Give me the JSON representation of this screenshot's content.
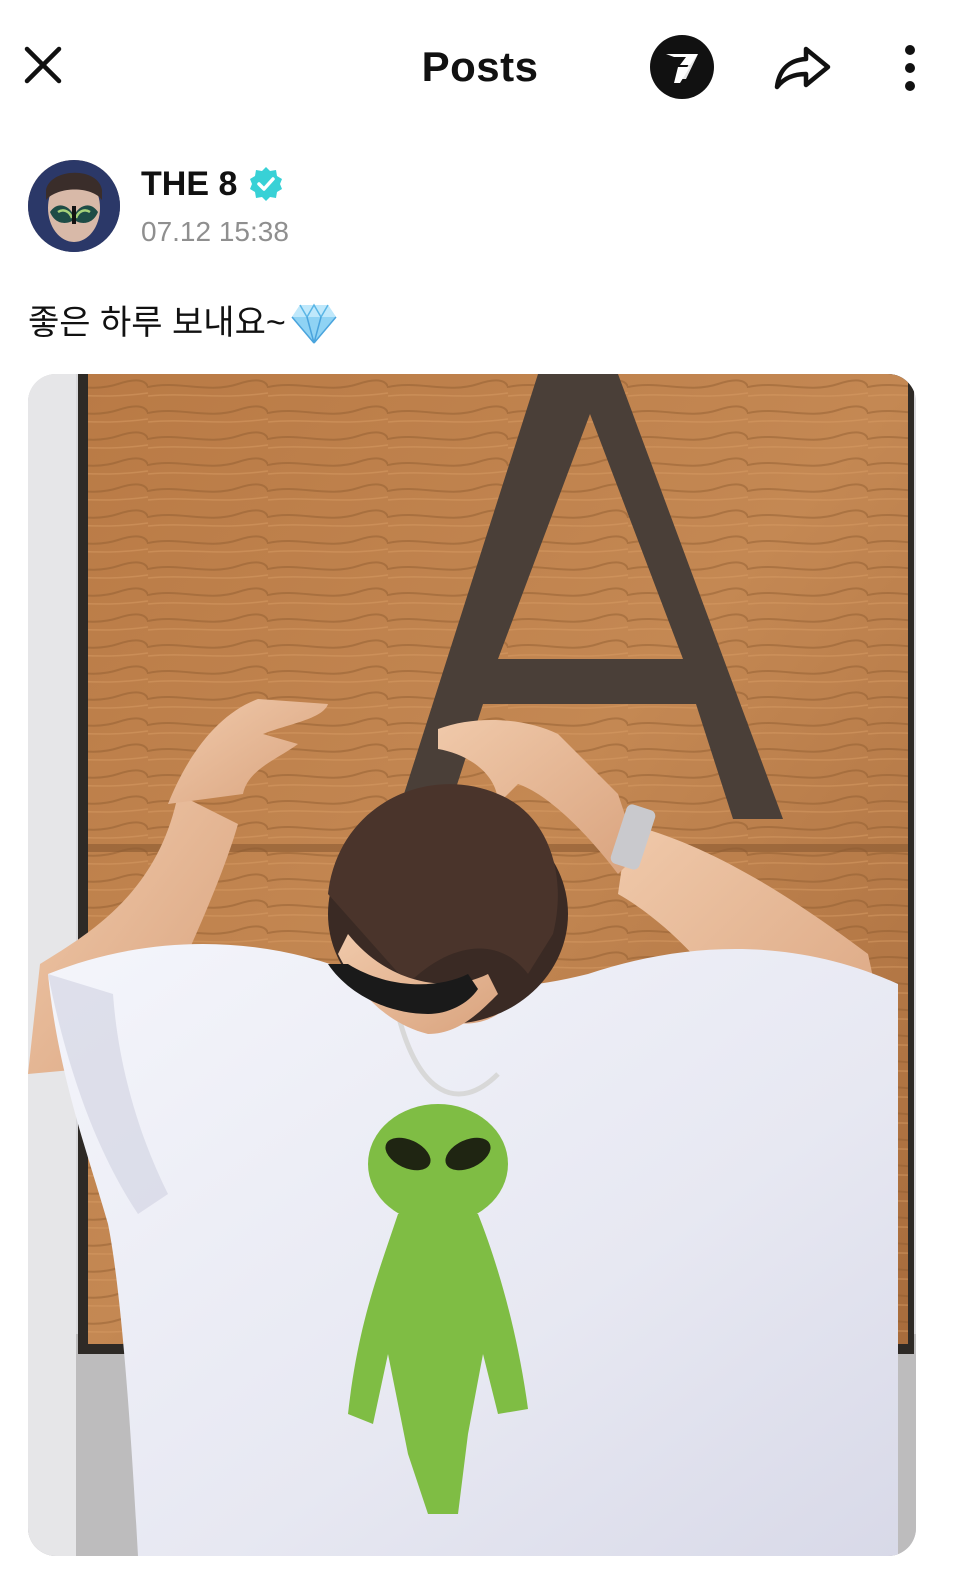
{
  "header": {
    "title": "Posts",
    "close_icon": "close-icon",
    "logo_icon": "seventeen-logo-icon",
    "share_icon": "share-icon",
    "more_icon": "more-vertical-icon"
  },
  "post": {
    "author": {
      "name": "THE 8",
      "verified": true,
      "verified_color": "#38d1d6"
    },
    "timestamp": "07.12 15:38",
    "text": "좋은 하루 보내요~",
    "emoji_icon": "diamond-icon",
    "photo": {
      "description_icon": "post-photo"
    }
  },
  "colors": {
    "text": "#111111",
    "muted": "#8f8f8f",
    "accent": "#38d1d6"
  }
}
